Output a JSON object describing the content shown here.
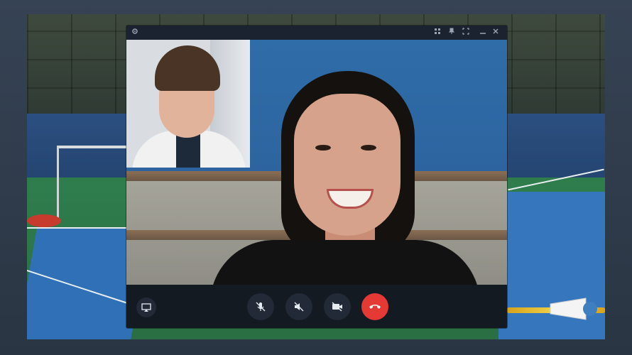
{
  "window": {
    "title_icons": [
      "settings-icon",
      "grid-view-icon",
      "pin-icon",
      "fullscreen-icon",
      "minimize-icon",
      "close-icon"
    ]
  },
  "controls": {
    "left": [
      "screen-share-icon"
    ],
    "center": [
      "microphone-off-icon",
      "speaker-off-icon",
      "camera-off-icon",
      "end-call-icon"
    ]
  },
  "colors": {
    "end_call": "#e53935",
    "control_bg": "#212a36",
    "window_bg": "#151a22"
  }
}
